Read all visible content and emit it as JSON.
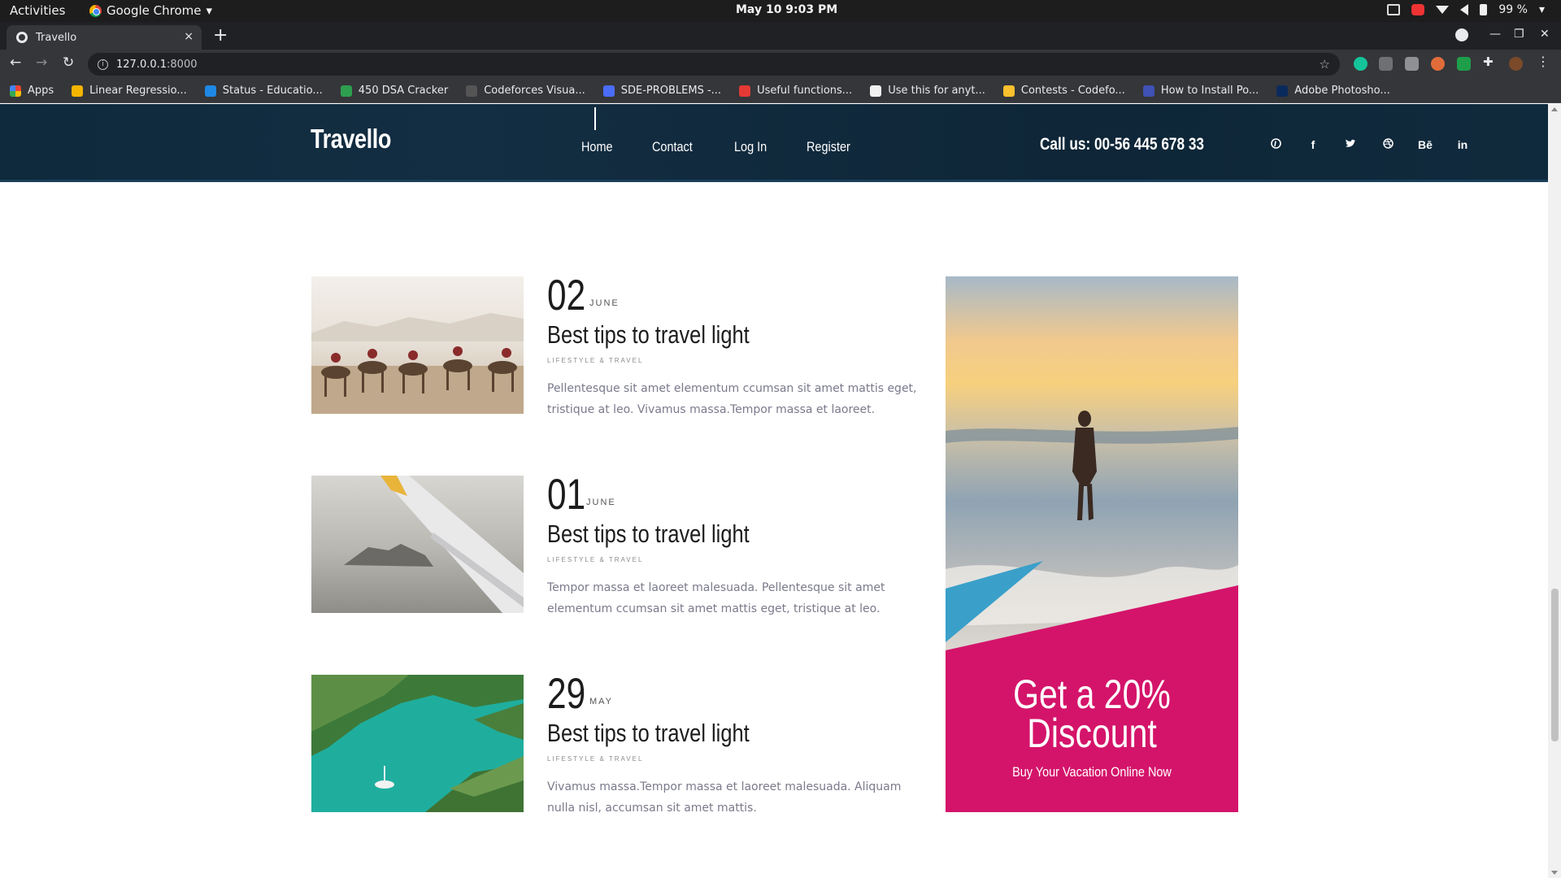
{
  "system_bar": {
    "activities": "Activities",
    "app_name": "Google Chrome",
    "clock": "May 10  9:03 PM",
    "battery": "99 %"
  },
  "browser": {
    "tab_title": "Travello",
    "tab_close": "×",
    "new_tab": "+",
    "url_host": "127.0.0.1",
    "url_port": ":8000",
    "bookmarks": [
      {
        "label": "Apps",
        "icon": "apps-grid-icon",
        "color": "#4285f4"
      },
      {
        "label": "Linear Regressio...",
        "icon": "linear-regression-favicon",
        "color": "#f4b400"
      },
      {
        "label": "Status - Educatio...",
        "icon": "codeforces-favicon",
        "color": "#1e88e5"
      },
      {
        "label": "450 DSA Cracker",
        "icon": "dsa-cracker-favicon",
        "color": "#2e9e4f"
      },
      {
        "label": "Codeforces Visua...",
        "icon": "cfv-favicon",
        "color": "#555555"
      },
      {
        "label": "SDE-PROBLEMS -...",
        "icon": "docs-favicon",
        "color": "#4a6cf7"
      },
      {
        "label": "Useful functions...",
        "icon": "codeforces-favicon",
        "color": "#e53935"
      },
      {
        "label": "Use this for anyt...",
        "icon": "chat-favicon",
        "color": "#f1f1f1"
      },
      {
        "label": "Contests - Codefo...",
        "icon": "codeforces-favicon",
        "color": "#fbc02d"
      },
      {
        "label": "How to Install Po...",
        "icon": "install-favicon",
        "color": "#3f51b5"
      },
      {
        "label": "Adobe Photosho...",
        "icon": "photoshop-favicon",
        "color": "#0a2a5c"
      }
    ]
  },
  "site": {
    "logo": "Travello",
    "nav": [
      "Home",
      "Contact",
      "Log In",
      "Register"
    ],
    "call_us": "Call us: 00-56 445 678 33",
    "socials": [
      {
        "label": "",
        "icon": "pinterest-icon",
        "glyph": "⊘"
      },
      {
        "label": "f",
        "icon": "facebook-icon",
        "glyph": "f"
      },
      {
        "label": "",
        "icon": "twitter-icon",
        "glyph": "🐦"
      },
      {
        "label": "",
        "icon": "dribbble-icon",
        "glyph": "◎"
      },
      {
        "label": "Bē",
        "icon": "behance-icon",
        "glyph": "Bē"
      },
      {
        "label": "in",
        "icon": "linkedin-icon",
        "glyph": "in"
      }
    ]
  },
  "posts": [
    {
      "day": "02",
      "month": "JUNE",
      "title": "Best tips to travel light",
      "tags": "LIFESTYLE & TRAVEL",
      "excerpt": "Pellentesque sit amet elementum ccumsan sit amet mattis eget, tristique at leo. Vivamus massa.Tempor massa et laoreet.",
      "image": "desert-camels-photo"
    },
    {
      "day": "01",
      "month": "JUNE",
      "title": "Best tips to travel light",
      "tags": "LIFESTYLE & TRAVEL",
      "excerpt": "Tempor massa et laoreet malesuada. Pellentesque sit amet elementum ccumsan sit amet mattis eget, tristique at leo.",
      "image": "airplane-wing-photo"
    },
    {
      "day": "29",
      "month": "MAY",
      "title": "Best tips to travel light",
      "tags": "LIFESTYLE & TRAVEL",
      "excerpt": "Vivamus massa.Tempor massa et laoreet malesuada. Aliquam nulla nisl, accumsan sit amet mattis.",
      "image": "coast-boat-photo"
    }
  ],
  "promo": {
    "title": "Get a 20% Discount",
    "subtitle": "Buy Your Vacation Online Now",
    "accent": "#d4146a"
  }
}
